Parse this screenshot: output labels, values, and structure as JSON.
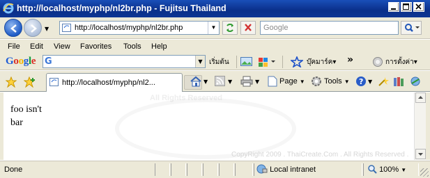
{
  "window": {
    "title": "http://localhost/myphp/nl2br.php - Fujitsu Thailand"
  },
  "address_bar": {
    "url": "http://localhost/myphp/nl2br.php"
  },
  "search_box": {
    "placeholder": "Google"
  },
  "menu": {
    "items": [
      "File",
      "Edit",
      "View",
      "Favorites",
      "Tools",
      "Help"
    ]
  },
  "google_toolbar": {
    "logo": "Google",
    "g_letter": "G",
    "start_label": "เริ่มต้น",
    "bookmarks_label": "บุ๊คมาร์ค",
    "more_label": "»",
    "settings_label": "การตั้งค่า"
  },
  "tab": {
    "title": "http://localhost/myphp/nl2..."
  },
  "command_bar": {
    "page_label": "Page",
    "tools_label": "Tools"
  },
  "content": {
    "lines": [
      "foo isn't",
      "bar"
    ],
    "copyright": "CopyRight 2009 . ThaiCreate.Com . All Rights Reserved .",
    "watermark_text": "All Rights Reserved"
  },
  "status_bar": {
    "status_text": "Done",
    "zone": "Local intranet",
    "zoom": "100%"
  },
  "colors": {
    "titlebar": "#0a2f8a",
    "chrome": "#ece9d8",
    "accent": "#1e5bc6"
  }
}
